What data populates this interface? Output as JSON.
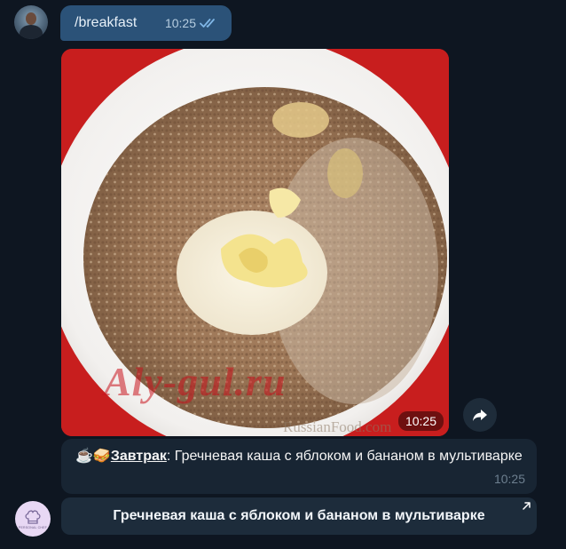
{
  "outgoing": {
    "command": "/breakfast",
    "time": "10:25",
    "status": "read"
  },
  "photo": {
    "time": "10:25",
    "watermark_main": "Aly-gul.ru",
    "watermark_secondary": "RussianFood.com"
  },
  "message": {
    "emoji": "☕🥪",
    "label": "Завтрак",
    "separator": ":",
    "text": " Гречневая каша с яблоком и бананом в мультиварке",
    "time": "10:25"
  },
  "bot": {
    "avatar_text": "PERSONAL CHEF"
  },
  "keyboard": {
    "button_label": "Гречневая каша с яблоком и бананом в мультиварке"
  },
  "colors": {
    "background": "#0e1621",
    "outgoing_bubble": "#2b5278",
    "incoming_bubble": "#182533",
    "button": "#1d2c3b"
  }
}
